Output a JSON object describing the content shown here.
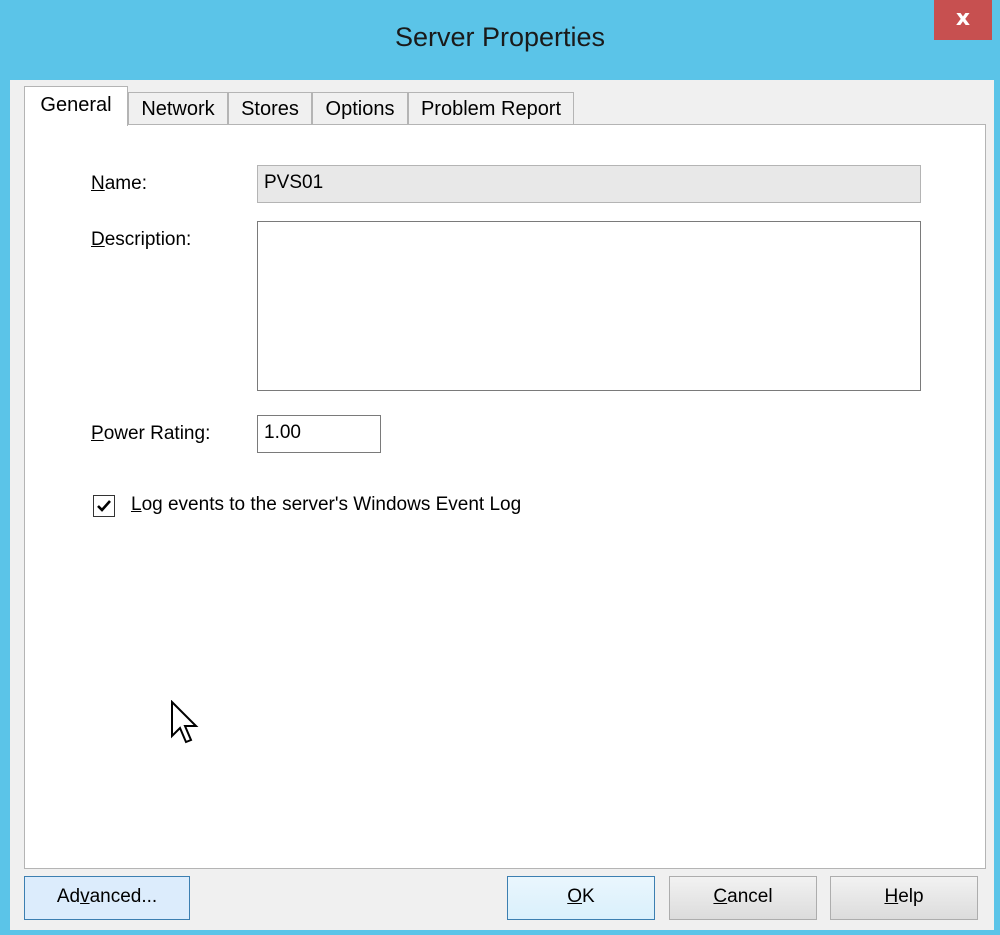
{
  "window": {
    "title": "Server Properties",
    "close_glyph": "x"
  },
  "tabs": [
    {
      "label": "General",
      "active": true
    },
    {
      "label": "Network",
      "active": false
    },
    {
      "label": "Stores",
      "active": false
    },
    {
      "label": "Options",
      "active": false
    },
    {
      "label": "Problem Report",
      "active": false
    }
  ],
  "form": {
    "name_label": "Name:",
    "name_value": "PVS01",
    "description_label": "Description:",
    "description_value": "",
    "power_rating_label": "Power Rating:",
    "power_rating_value": "1.00",
    "log_events_label": "Log events to the server's Windows Event Log",
    "log_events_checked": true
  },
  "buttons": {
    "advanced": "Advanced...",
    "ok": "OK",
    "cancel": "Cancel",
    "help": "Help"
  },
  "colors": {
    "titlebar": "#5bc4e8",
    "close": "#c75050"
  }
}
